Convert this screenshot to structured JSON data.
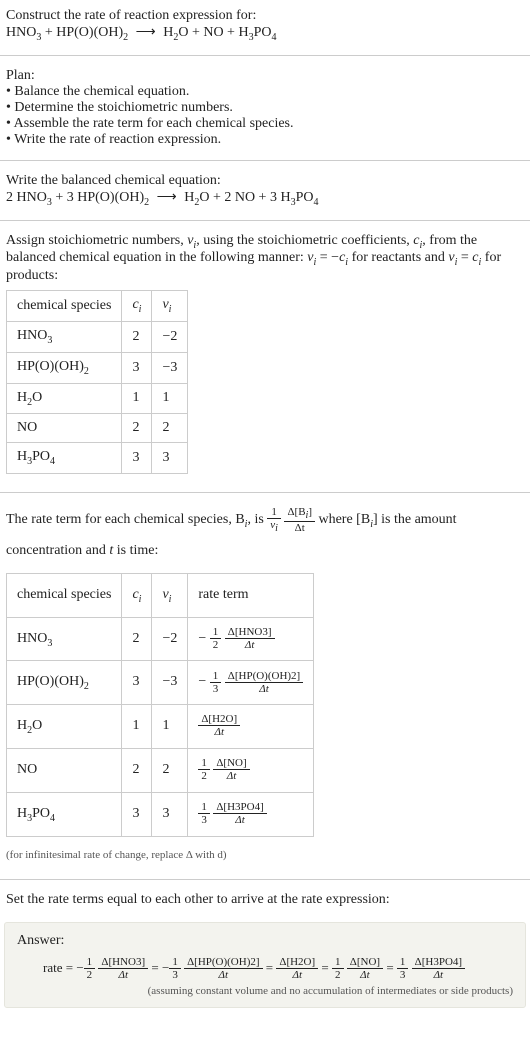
{
  "header": {
    "prompt": "Construct the rate of reaction expression for:",
    "equation_left": "HNO",
    "equation": {
      "t1": "HNO",
      "s1": "3",
      "plus1": " + HP(O)(OH)",
      "s2": "2",
      "arrow": "⟶",
      "t2": "H",
      "s3": "2",
      "t3": "O + NO + H",
      "s4": "3",
      "t4": "PO",
      "s5": "4"
    }
  },
  "plan": {
    "title": "Plan:",
    "b1": "• Balance the chemical equation.",
    "b2": "• Determine the stoichiometric numbers.",
    "b3": "• Assemble the rate term for each chemical species.",
    "b4": "• Write the rate of reaction expression."
  },
  "balanced": {
    "title": "Write the balanced chemical equation:",
    "t1": "2 HNO",
    "s1": "3",
    "t2": " + 3 HP(O)(OH)",
    "s2": "2",
    "arrow": "⟶",
    "t3": "H",
    "s3": "2",
    "t4": "O + 2 NO + 3 H",
    "s4": "3",
    "t5": "PO",
    "s5": "4"
  },
  "stoich_intro": {
    "p1": "Assign stoichiometric numbers, ",
    "nu": "ν",
    "i1": "i",
    "p2": ", using the stoichiometric coefficients, ",
    "c": "c",
    "i2": "i",
    "p3": ", from the balanced chemical equation in the following manner: ",
    "eq1a": "ν",
    "eq1b": "i",
    "eq1c": " = −",
    "eq1d": "c",
    "eq1e": "i",
    "p4": " for reactants and ",
    "eq2a": "ν",
    "eq2b": "i",
    "eq2c": " = ",
    "eq2d": "c",
    "eq2e": "i",
    "p5": " for products:"
  },
  "table1": {
    "h1": "chemical species",
    "h2": "c",
    "h2s": "i",
    "h3": "ν",
    "h3s": "i",
    "r1c1a": "HNO",
    "r1c1b": "3",
    "r1c2": "2",
    "r1c3": "−2",
    "r2c1a": "HP(O)(OH)",
    "r2c1b": "2",
    "r2c2": "3",
    "r2c3": "−3",
    "r3c1a": "H",
    "r3c1b": "2",
    "r3c1c": "O",
    "r3c2": "1",
    "r3c3": "1",
    "r4c1": "NO",
    "r4c2": "2",
    "r4c3": "2",
    "r5c1a": "H",
    "r5c1b": "3",
    "r5c1c": "PO",
    "r5c1d": "4",
    "r5c2": "3",
    "r5c3": "3"
  },
  "rate_intro": {
    "p1": "The rate term for each chemical species, B",
    "i1": "i",
    "p2": ", is ",
    "one": "1",
    "nu": "ν",
    "nui": "i",
    "dbi": "Δ[B",
    "dbis": "i",
    "dbie": "]",
    "dt": "Δt",
    "p3": " where [B",
    "p3s": "i",
    "p3e": "] is the amount concentration and ",
    "tvar": "t",
    "p4": " is time:"
  },
  "table2": {
    "h1": "chemical species",
    "h2": "c",
    "h2s": "i",
    "h3": "ν",
    "h3s": "i",
    "h4": "rate term",
    "r1": {
      "spA": "HNO",
      "spB": "3",
      "c": "2",
      "nu": "−2",
      "neg": "−",
      "fn": "1",
      "fd": "2",
      "dn": "Δ[HNO3]",
      "dd": "Δt"
    },
    "r2": {
      "spA": "HP(O)(OH)",
      "spB": "2",
      "c": "3",
      "nu": "−3",
      "neg": "−",
      "fn": "1",
      "fd": "3",
      "dn": "Δ[HP(O)(OH)2]",
      "dd": "Δt"
    },
    "r3": {
      "spA": "H",
      "spB": "2",
      "spC": "O",
      "c": "1",
      "nu": "1",
      "neg": "",
      "fn": "",
      "fd": "",
      "dn": "Δ[H2O]",
      "dd": "Δt"
    },
    "r4": {
      "spA": "NO",
      "spB": "",
      "c": "2",
      "nu": "2",
      "neg": "",
      "fn": "1",
      "fd": "2",
      "dn": "Δ[NO]",
      "dd": "Δt"
    },
    "r5": {
      "spA": "H",
      "spB": "3",
      "spC": "PO",
      "spD": "4",
      "c": "3",
      "nu": "3",
      "neg": "",
      "fn": "1",
      "fd": "3",
      "dn": "Δ[H3PO4]",
      "dd": "Δt"
    }
  },
  "inf_note": "(for infinitesimal rate of change, replace Δ with d)",
  "final_intro": "Set the rate terms equal to each other to arrive at the rate expression:",
  "answer": {
    "label": "Answer:",
    "rate": "rate = ",
    "t1": {
      "neg": "−",
      "fn": "1",
      "fd": "2",
      "dn": "Δ[HNO3]",
      "dd": "Δt"
    },
    "eq1": " = ",
    "t2": {
      "neg": "−",
      "fn": "1",
      "fd": "3",
      "dn": "Δ[HP(O)(OH)2]",
      "dd": "Δt"
    },
    "eq2": " = ",
    "t3": {
      "neg": "",
      "fn": "",
      "fd": "",
      "dn": "Δ[H2O]",
      "dd": "Δt"
    },
    "eq3": " = ",
    "t4": {
      "neg": "",
      "fn": "1",
      "fd": "2",
      "dn": "Δ[NO]",
      "dd": "Δt"
    },
    "eq4": " = ",
    "t5": {
      "neg": "",
      "fn": "1",
      "fd": "3",
      "dn": "Δ[H3PO4]",
      "dd": "Δt"
    },
    "note": "(assuming constant volume and no accumulation of intermediates or side products)"
  },
  "chart_data": {
    "type": "table",
    "tables": [
      {
        "title": "stoichiometric numbers",
        "columns": [
          "chemical species",
          "c_i",
          "ν_i"
        ],
        "rows": [
          [
            "HNO3",
            2,
            -2
          ],
          [
            "HP(O)(OH)2",
            3,
            -3
          ],
          [
            "H2O",
            1,
            1
          ],
          [
            "NO",
            2,
            2
          ],
          [
            "H3PO4",
            3,
            3
          ]
        ]
      },
      {
        "title": "rate terms",
        "columns": [
          "chemical species",
          "c_i",
          "ν_i",
          "rate term"
        ],
        "rows": [
          [
            "HNO3",
            2,
            -2,
            "-(1/2) Δ[HNO3]/Δt"
          ],
          [
            "HP(O)(OH)2",
            3,
            -3,
            "-(1/3) Δ[HP(O)(OH)2]/Δt"
          ],
          [
            "H2O",
            1,
            1,
            "Δ[H2O]/Δt"
          ],
          [
            "NO",
            2,
            2,
            "(1/2) Δ[NO]/Δt"
          ],
          [
            "H3PO4",
            3,
            3,
            "(1/3) Δ[H3PO4]/Δt"
          ]
        ]
      }
    ]
  }
}
